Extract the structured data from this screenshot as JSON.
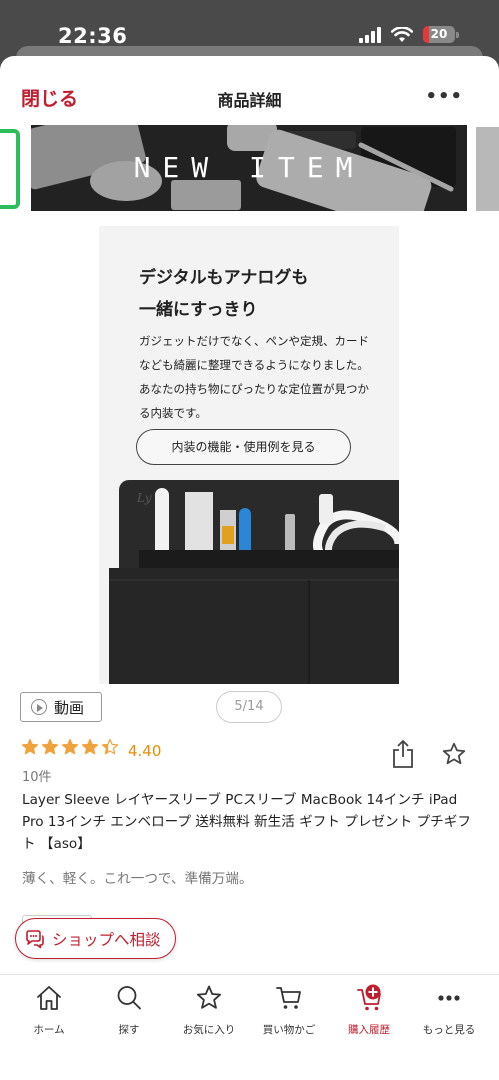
{
  "status_bar": {
    "time": "22:36",
    "battery": "20",
    "battery_level": 0.2
  },
  "header": {
    "close_label": "閉じる",
    "title": "商品詳細",
    "more_label": "•••"
  },
  "banner": {
    "text": "NEW ITEM"
  },
  "product_image": {
    "heading_line1": "デジタルもアナログも",
    "heading_line2": "一緒にすっきり",
    "body": "ガジェットだけでなく、ペンや定規、カードなども綺麗に整理できるようになりました。あなたの持ち物にぴったりな定位置が見つかる内装です。",
    "button_label": "内装の機能・使用例を見る",
    "logo_text": "Ly"
  },
  "media": {
    "video_label": "動画",
    "image_counter": "5/14"
  },
  "rating": {
    "value": "4.40",
    "stars": 4.4,
    "max_stars": 5,
    "review_count": "10件",
    "star_color": "#f0a23c"
  },
  "product": {
    "title": "Layer Sleeve レイヤースリーブ PCスリーブ MacBook 14インチ iPad Pro 13インチ エンベロープ 送料無料 新生活 ギフト プレゼント プチギフト 【aso】",
    "tagline": "薄く、軽く。これ一つで、準備万端。"
  },
  "shop_consult": {
    "label": "ショップへ相談"
  },
  "bottom_nav": {
    "items": [
      {
        "label": "ホーム",
        "icon": "home-icon"
      },
      {
        "label": "探す",
        "icon": "search-icon"
      },
      {
        "label": "お気に入り",
        "icon": "star-icon"
      },
      {
        "label": "買い物かご",
        "icon": "cart-icon"
      },
      {
        "label": "購入履歴",
        "icon": "purchase-history-icon",
        "active": true
      },
      {
        "label": "もっと見る",
        "icon": "more-icon"
      }
    ]
  },
  "colors": {
    "brand_red": "#bf1f2f",
    "rating_orange": "#ea8c00",
    "banner_border_green": "#2dbd5a"
  }
}
